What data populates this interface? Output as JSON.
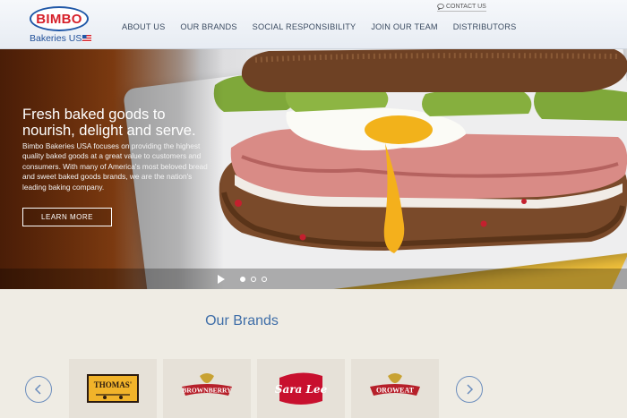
{
  "header": {
    "logo": {
      "wordmark": "BIMBO",
      "sub": "Bakeries USA"
    },
    "contact_label": "CONTACT US",
    "nav": [
      {
        "label": "ABOUT US"
      },
      {
        "label": "OUR BRANDS"
      },
      {
        "label": "SOCIAL RESPONSIBILITY"
      },
      {
        "label": "JOIN OUR TEAM"
      },
      {
        "label": "DISTRIBUTORS"
      }
    ]
  },
  "hero": {
    "title": "Fresh baked goods to nourish, delight and serve.",
    "text": "Bimbo Bakeries USA focuses on providing the highest quality baked goods at a great value to customers and consumers. With many of America's most beloved bread and sweet baked goods brands, we are the nation's leading baking company.",
    "button_label": "LEARN MORE",
    "slides_total": 3,
    "active_slide": 1
  },
  "brands": {
    "title": "Our Brands",
    "items": [
      {
        "name": "THOMAS'"
      },
      {
        "name": "BROWNBERRY"
      },
      {
        "name": "Sara Lee"
      },
      {
        "name": "OROWEAT"
      }
    ]
  },
  "colors": {
    "brand_red": "#d6202a",
    "brand_blue": "#1f57a7",
    "title_blue": "#3f6ea8"
  }
}
